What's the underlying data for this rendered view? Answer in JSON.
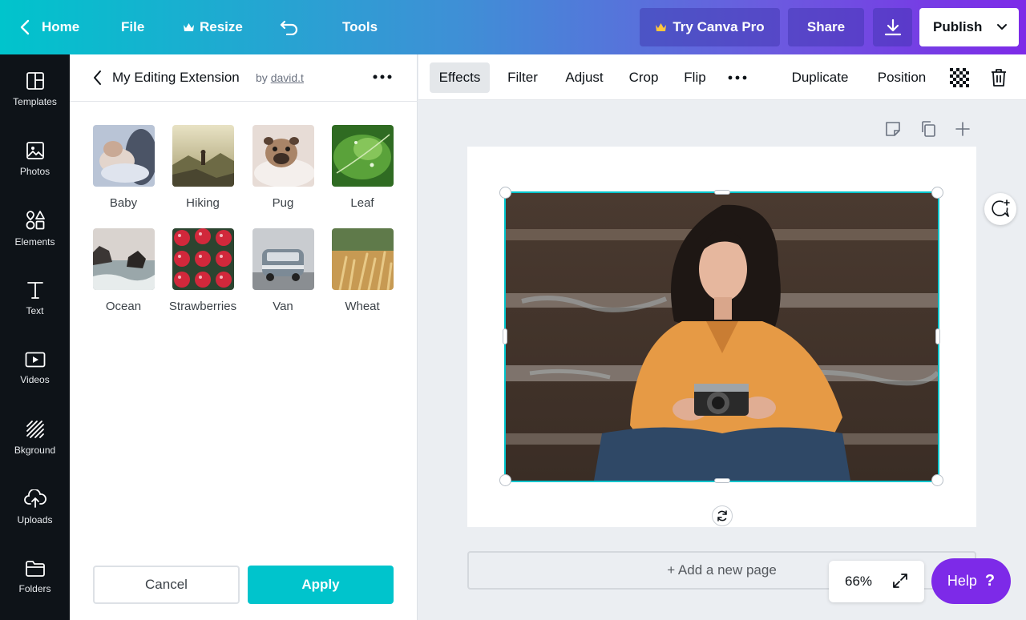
{
  "topbar": {
    "home": "Home",
    "file": "File",
    "resize": "Resize",
    "tools": "Tools",
    "try_pro": "Try Canva Pro",
    "share": "Share",
    "publish": "Publish"
  },
  "rail": {
    "items": [
      {
        "label": "Templates",
        "icon": "templates-icon"
      },
      {
        "label": "Photos",
        "icon": "photos-icon"
      },
      {
        "label": "Elements",
        "icon": "elements-icon"
      },
      {
        "label": "Text",
        "icon": "text-icon"
      },
      {
        "label": "Videos",
        "icon": "videos-icon"
      },
      {
        "label": "Bkground",
        "icon": "background-icon"
      },
      {
        "label": "Uploads",
        "icon": "uploads-icon"
      },
      {
        "label": "Folders",
        "icon": "folders-icon"
      }
    ]
  },
  "panel": {
    "title": "My Editing Extension",
    "by": "by",
    "author": "david.t",
    "thumbnails": [
      {
        "label": "Baby"
      },
      {
        "label": "Hiking"
      },
      {
        "label": "Pug"
      },
      {
        "label": "Leaf"
      },
      {
        "label": "Ocean"
      },
      {
        "label": "Strawberries"
      },
      {
        "label": "Van"
      },
      {
        "label": "Wheat"
      }
    ],
    "cancel": "Cancel",
    "apply": "Apply"
  },
  "editor": {
    "tools": [
      "Effects",
      "Filter",
      "Adjust",
      "Crop",
      "Flip"
    ],
    "active_tool": "Effects",
    "duplicate": "Duplicate",
    "position": "Position",
    "add_page": "+ Add a new page",
    "zoom": "66%",
    "help": "Help",
    "help_mark": "?"
  },
  "colors": {
    "accent": "#00c4cc",
    "purple": "#7d2ae8",
    "rail": "#0e1318"
  }
}
